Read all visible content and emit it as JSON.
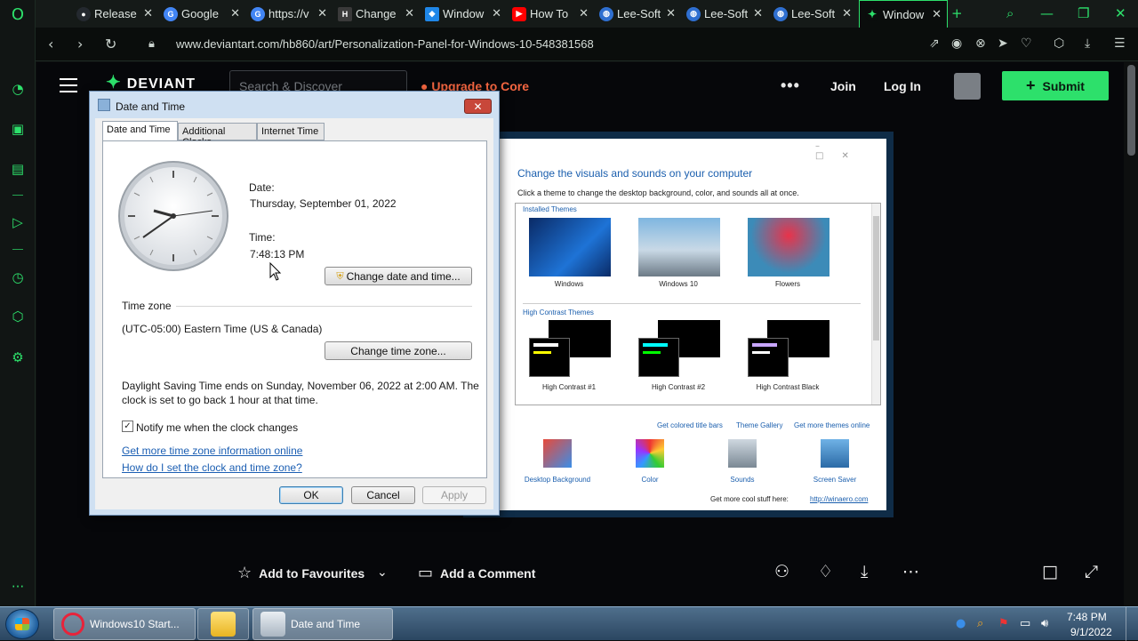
{
  "browser": {
    "tabs": [
      {
        "label": "Release",
        "icon": "github-icon",
        "color": "#24292f"
      },
      {
        "label": "Google",
        "icon": "google-icon",
        "color": "#4285f4"
      },
      {
        "label": "https://v",
        "icon": "google-icon",
        "color": "#4285f4"
      },
      {
        "label": "Change",
        "icon": "htg-icon",
        "color": "#3a3a3a"
      },
      {
        "label": "Window",
        "icon": "windows-icon",
        "color": "#1f87e8"
      },
      {
        "label": "How To",
        "icon": "youtube-icon",
        "color": "#ff0000"
      },
      {
        "label": "Lee-Soft",
        "icon": "globe-icon",
        "color": "#2f6fd0"
      },
      {
        "label": "Lee-Soft",
        "icon": "globe-icon",
        "color": "#2f6fd0"
      },
      {
        "label": "Lee-Soft",
        "icon": "globe-icon",
        "color": "#2f6fd0"
      },
      {
        "label": "Window",
        "icon": "deviantart-icon",
        "color": "#2de06b",
        "active": true
      }
    ],
    "url": "www.deviantart.com/hb860/art/Personalization-Panel-for-Windows-10-548381568",
    "accent": "#2de06b"
  },
  "deviantart": {
    "logo_text": "DEVIANT",
    "search_placeholder": "Search & Discover",
    "upgrade_label": "Upgrade to Core",
    "more_label": "•••",
    "join_label": "Join",
    "login_label": "Log In",
    "submit_label": "Submit",
    "actions": {
      "favourite_label": "Add to Favourites",
      "comment_label": "Add a Comment"
    }
  },
  "preview": {
    "title": "Change the visuals and sounds on your computer",
    "subtitle": "Click a theme to change the desktop background, color, and sounds all at once.",
    "installed_heading": "Installed Themes",
    "installed": [
      "Windows",
      "Windows 10",
      "Flowers"
    ],
    "contrast_heading": "High Contrast Themes",
    "contrast": [
      "High Contrast #1",
      "High Contrast #2",
      "High Contrast Black"
    ],
    "links": [
      "Get colored title bars",
      "Theme Gallery",
      "Get more themes online"
    ],
    "bottom": [
      "Desktop Background",
      "Color",
      "Sounds",
      "Screen Saver"
    ],
    "footer_text": "Get more cool stuff here:",
    "footer_link": "http://winaero.com"
  },
  "dialog": {
    "title": "Date and Time",
    "tabs": [
      "Date and Time",
      "Additional Clocks",
      "Internet Time"
    ],
    "date_label": "Date:",
    "date_value": "Thursday, September 01, 2022",
    "time_label": "Time:",
    "time_value": "7:48:13 PM",
    "change_datetime_label": "Change date and time...",
    "timezone_heading": "Time zone",
    "timezone_value": "(UTC-05:00) Eastern Time (US & Canada)",
    "change_timezone_label": "Change time zone...",
    "dst_line1": "Daylight Saving Time ends on Sunday, November 06, 2022 at 2:00 AM. The",
    "dst_line2": "clock is set to go back 1 hour at that time.",
    "notify_label": "Notify me when the clock changes",
    "notify_checked": true,
    "link_tz_info": "Get more time zone information online",
    "link_how_set": "How do I set the clock and time zone?",
    "ok_label": "OK",
    "cancel_label": "Cancel",
    "apply_label": "Apply"
  },
  "taskbar": {
    "items": [
      {
        "label": "Windows10 Start...",
        "icon": "opera-icon"
      },
      {
        "label": "",
        "icon": "folder-icon"
      },
      {
        "label": "Date and Time",
        "icon": "calendar-icon"
      }
    ],
    "clock_time": "7:48 PM",
    "clock_date": "9/1/2022"
  }
}
